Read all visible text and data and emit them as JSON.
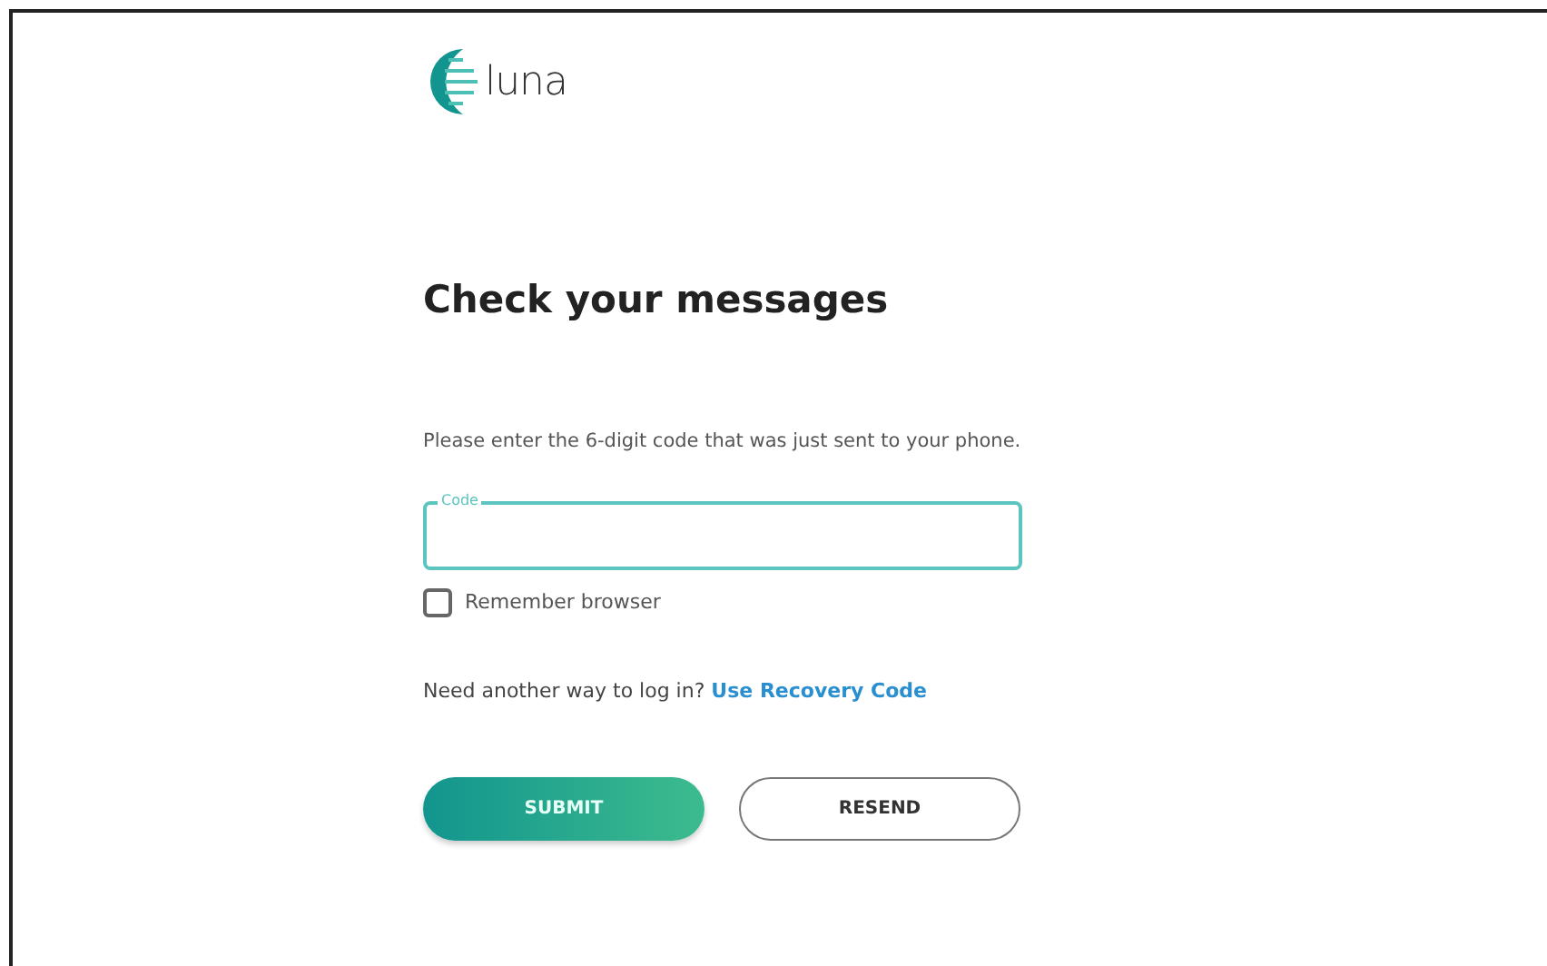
{
  "logo": {
    "text": "luna"
  },
  "heading": "Check your messages",
  "instructions": "Please enter the 6-digit code that was just sent to your phone.",
  "code_field": {
    "label": "Code",
    "focused": true
  },
  "remember_browser": {
    "label": "Remember browser",
    "checked": false
  },
  "alternative": {
    "text": "Need another way to log in?",
    "link": "Use Recovery Code"
  },
  "buttons": [
    {
      "label": "SUBMIT",
      "kind": "primary"
    },
    {
      "label": "RESEND",
      "kind": "outline"
    }
  ]
}
